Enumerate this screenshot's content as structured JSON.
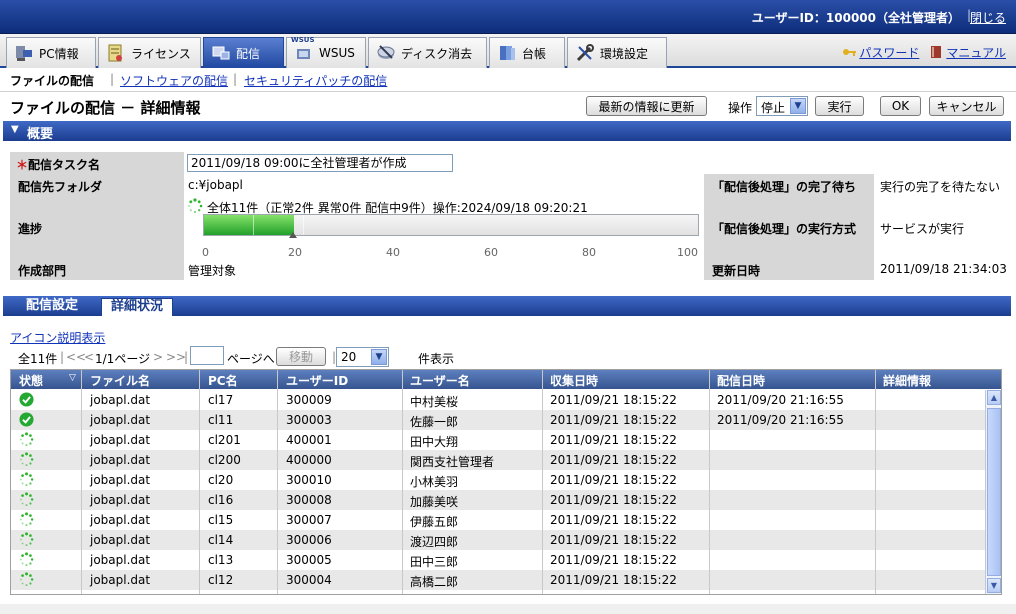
{
  "header": {
    "user_label": "ユーザーID：100000（全社管理者）",
    "close_label": "閉じる"
  },
  "tabs": [
    {
      "label": "PC情報",
      "icon": "pc-icon"
    },
    {
      "label": "ライセンス",
      "icon": "license-icon"
    },
    {
      "label": "配信",
      "icon": "distribution-icon",
      "active": true
    },
    {
      "label": "WSUS",
      "icon": "wsus-icon",
      "badge": "WSUS"
    },
    {
      "label": "ディスク消去",
      "icon": "disk-erase-icon"
    },
    {
      "label": "台帳",
      "icon": "ledger-icon"
    },
    {
      "label": "環境設定",
      "icon": "settings-icon"
    }
  ],
  "toplinks": {
    "password": "パスワード",
    "manual": "マニュアル"
  },
  "subnav": {
    "current": "ファイルの配信",
    "software": "ソフトウェアの配信",
    "patch": "セキュリティパッチの配信"
  },
  "page": {
    "title": "ファイルの配信 － 詳細情報"
  },
  "toolbar": {
    "refresh": "最新の情報に更新",
    "op_label": "操作",
    "op_value": "停止",
    "run": "実行",
    "ok": "OK",
    "cancel": "キャンセル"
  },
  "overview": {
    "section_title": "概要",
    "task_label": "配信タスク名",
    "task_value": "2011/09/18 09:00に全社管理者が作成",
    "folder_label": "配信先フォルダ",
    "folder_value": "c:¥jobapl",
    "progress_label": "進捗",
    "progress_text": "全体11件（正常2件 異常0件 配信中9件）操作:2024/09/18 09:20:21",
    "progress_percent": 18.2,
    "ticks": [
      "0",
      "20",
      "40",
      "60",
      "80",
      "100"
    ],
    "dept_label": "作成部門",
    "dept_value": "管理対象",
    "wait_label": "「配信後処理」の完了待ち",
    "wait_value": "実行の完了を待たない",
    "method_label": "「配信後処理」の実行方式",
    "method_value": "サービスが実行",
    "updated_label": "更新日時",
    "updated_value": "2011/09/18 21:34:03"
  },
  "detail_tabs": {
    "settings": "配信設定",
    "status": "詳細状況"
  },
  "icon_desc": "アイコン説明表示",
  "pager": {
    "total": "全11件",
    "first": "<<",
    "prev": "<",
    "pages": "1/1ページ",
    "next": ">",
    "last": ">>",
    "page_suffix": "ページへ",
    "move": "移動",
    "per_page": "20",
    "per_page_suffix": "件表示"
  },
  "grid": {
    "columns": [
      "状態",
      "ファイル名",
      "PC名",
      "ユーザーID",
      "ユーザー名",
      "収集日時",
      "配信日時",
      "詳細情報"
    ],
    "rows": [
      {
        "status": "done",
        "file": "jobapl.dat",
        "pc": "cl17",
        "uid": "300009",
        "uname": "中村美桜",
        "collected": "2011/09/21 18:15:22",
        "delivered": "2011/09/20 21:16:55"
      },
      {
        "status": "done",
        "file": "jobapl.dat",
        "pc": "cl11",
        "uid": "300003",
        "uname": "佐藤一郎",
        "collected": "2011/09/21 18:15:22",
        "delivered": "2011/09/20 21:16:55"
      },
      {
        "status": "busy",
        "file": "jobapl.dat",
        "pc": "cl201",
        "uid": "400001",
        "uname": "田中大翔",
        "collected": "2011/09/21 18:15:22",
        "delivered": ""
      },
      {
        "status": "busy",
        "file": "jobapl.dat",
        "pc": "cl200",
        "uid": "400000",
        "uname": "関西支社管理者",
        "collected": "2011/09/21 18:15:22",
        "delivered": ""
      },
      {
        "status": "busy",
        "file": "jobapl.dat",
        "pc": "cl20",
        "uid": "300010",
        "uname": "小林美羽",
        "collected": "2011/09/21 18:15:22",
        "delivered": ""
      },
      {
        "status": "busy",
        "file": "jobapl.dat",
        "pc": "cl16",
        "uid": "300008",
        "uname": "加藤美咲",
        "collected": "2011/09/21 18:15:22",
        "delivered": ""
      },
      {
        "status": "busy",
        "file": "jobapl.dat",
        "pc": "cl15",
        "uid": "300007",
        "uname": "伊藤五郎",
        "collected": "2011/09/21 18:15:22",
        "delivered": ""
      },
      {
        "status": "busy",
        "file": "jobapl.dat",
        "pc": "cl14",
        "uid": "300006",
        "uname": "渡辺四郎",
        "collected": "2011/09/21 18:15:22",
        "delivered": ""
      },
      {
        "status": "busy",
        "file": "jobapl.dat",
        "pc": "cl13",
        "uid": "300005",
        "uname": "田中三郎",
        "collected": "2011/09/21 18:15:22",
        "delivered": ""
      },
      {
        "status": "busy",
        "file": "jobapl.dat",
        "pc": "cl12",
        "uid": "300004",
        "uname": "高橋二郎",
        "collected": "2011/09/21 18:15:22",
        "delivered": ""
      }
    ]
  },
  "colors": {
    "accent": "#1e3f8e",
    "ok": "#20a030",
    "progress": "#2db52c"
  }
}
